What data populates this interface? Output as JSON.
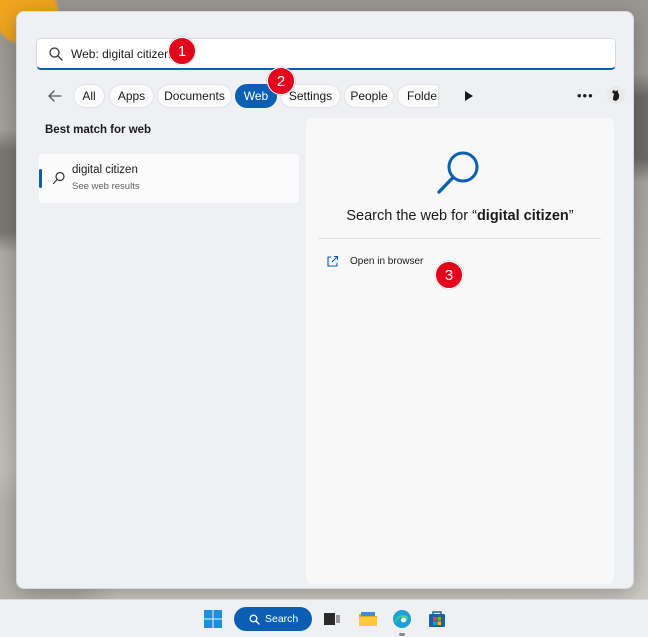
{
  "search": {
    "value": "Web: digital citizen",
    "icon": "search-icon"
  },
  "filters": [
    {
      "label": "All"
    },
    {
      "label": "Apps"
    },
    {
      "label": "Documents"
    },
    {
      "label": "Web",
      "selected": true
    },
    {
      "label": "Settings"
    },
    {
      "label": "People"
    },
    {
      "label": "Folde"
    }
  ],
  "best_match": {
    "heading": "Best match for web",
    "item": {
      "title": "digital citizen",
      "subtitle": "See web results"
    }
  },
  "preview": {
    "heading_prefix": "Search the web for “",
    "heading_term": "digital citizen",
    "heading_suffix": "”",
    "action_label": "Open in browser"
  },
  "annotations": [
    {
      "number": "1"
    },
    {
      "number": "2"
    },
    {
      "number": "3"
    }
  ],
  "taskbar": {
    "search_label": "Search"
  },
  "colors": {
    "accent": "#0a5fb4",
    "badge": "#e3051b"
  }
}
